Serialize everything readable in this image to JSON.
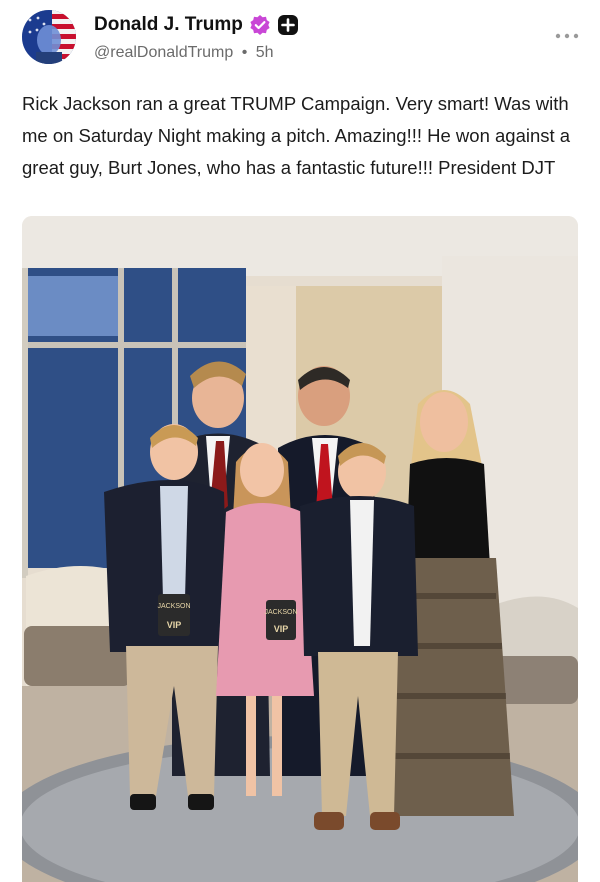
{
  "author": {
    "display_name": "Donald J. Trump",
    "handle": "@realDonaldTrump",
    "separator": "•",
    "time_ago": "5h",
    "avatar_icon": "american-flag-portrait-avatar",
    "verified_icon": "verified-badge-icon",
    "plus_icon": "plus-badge-icon",
    "accent_verified": "#c946d6"
  },
  "post": {
    "text": "Rick Jackson ran a great TRUMP Campaign. Very smart! Was with me on Saturday Night making a pitch. Amazing!!! He won against a great guy, Burt Jones, who has a fantastic future!!! President DJT"
  },
  "media": {
    "badges": [
      {
        "line1": "JACKSON",
        "line2": "VIP"
      },
      {
        "line1": "JACKSON",
        "line2": "VIP"
      }
    ]
  },
  "menu": {
    "more_icon": "more-horizontal-icon"
  }
}
